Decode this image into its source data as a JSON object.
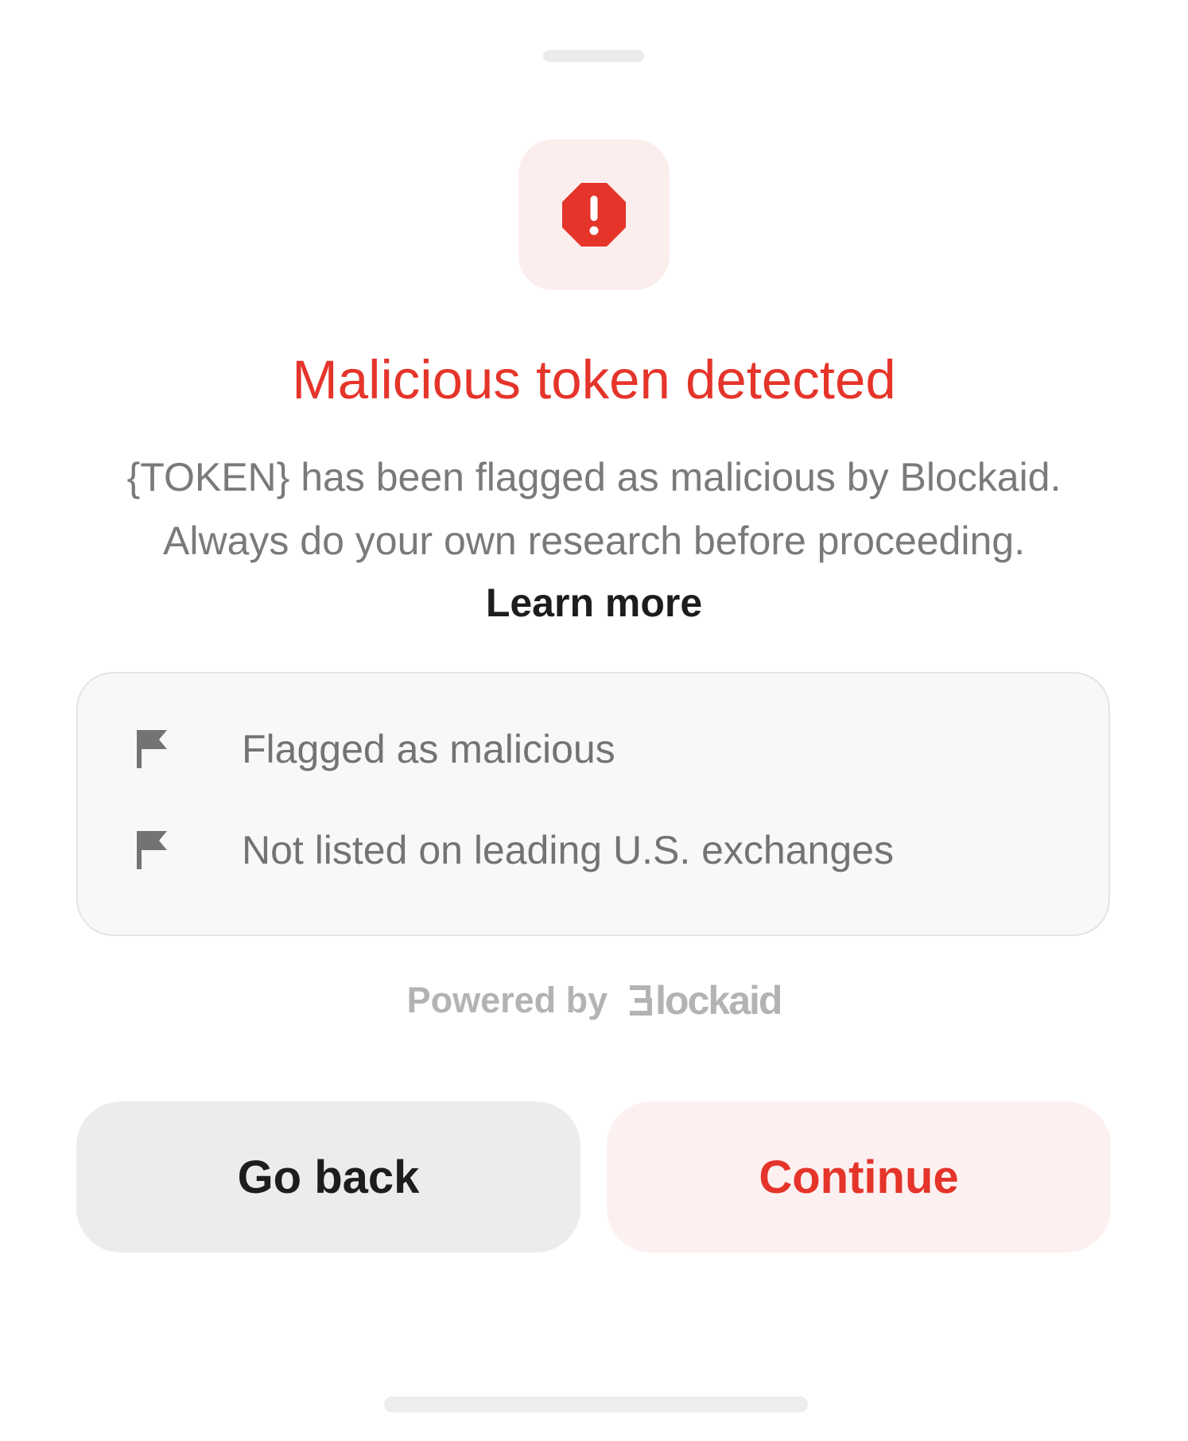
{
  "sheet": {
    "title": "Malicious token detected",
    "description_lines": [
      "{TOKEN} has been flagged as malicious by Blockaid.",
      "Always do your own research before proceeding."
    ],
    "learn_more_label": "Learn more",
    "warning_icon": "octagon-exclamation-icon"
  },
  "flags": [
    {
      "icon": "flag-icon",
      "label": "Flagged as malicious"
    },
    {
      "icon": "flag-icon",
      "label": "Not listed on leading U.S. exchanges"
    }
  ],
  "powered_by": {
    "label": "Powered by",
    "brand": "Blockaid",
    "brand_wordmark": "lockaid"
  },
  "actions": {
    "go_back_label": "Go back",
    "continue_label": "Continue"
  },
  "colors": {
    "danger": "#e5342a",
    "danger_tint": "#fdeeee",
    "neutral_button": "#ececec",
    "muted_text": "#7a7a7a"
  }
}
